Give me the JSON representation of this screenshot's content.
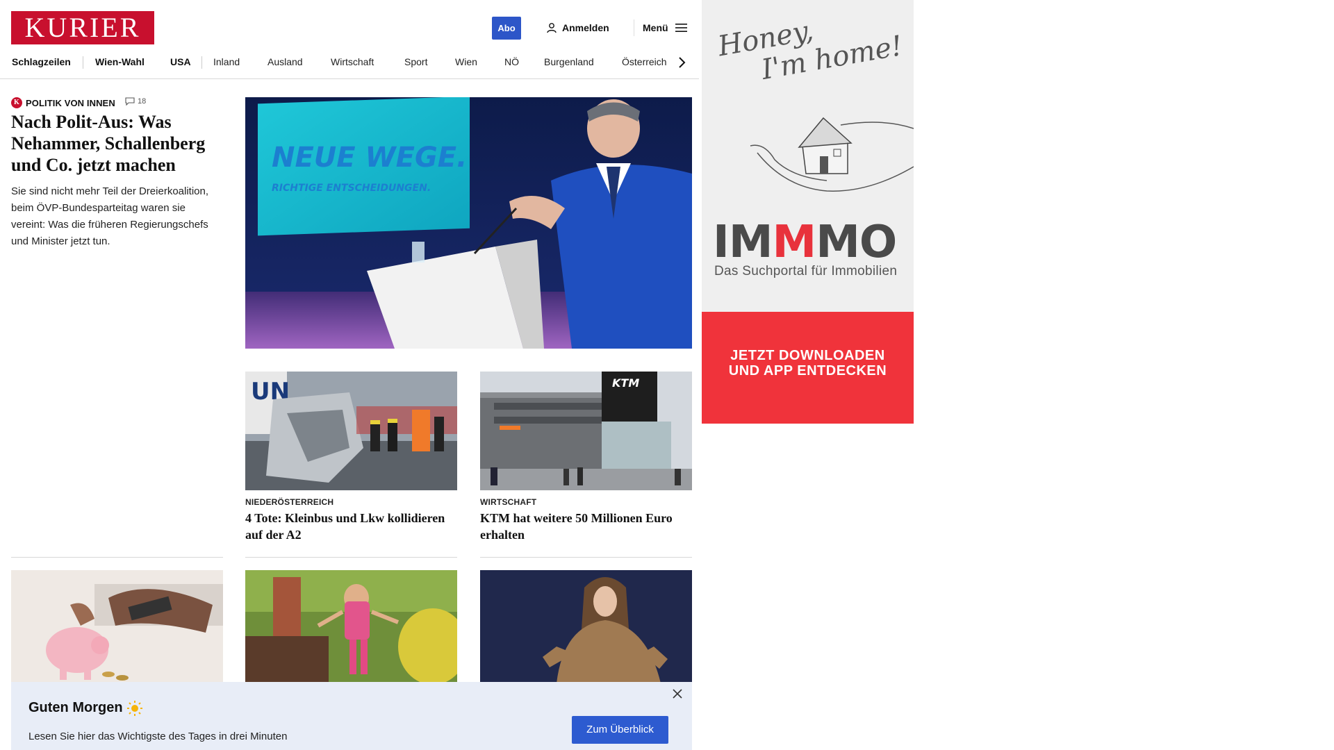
{
  "header": {
    "logo_text": "KURIER",
    "abo_label": "Abo",
    "login_label": "Anmelden",
    "menu_label": "Menü"
  },
  "nav": {
    "items": [
      "Schlagzeilen",
      "Wien-Wahl",
      "USA",
      "Inland",
      "Ausland",
      "Wirtschaft",
      "Sport",
      "Wien",
      "NÖ",
      "Burgenland",
      "Österreich"
    ]
  },
  "lead": {
    "badge_letter": "K",
    "kicker": "POLITIK VON INNEN",
    "comment_count": "18",
    "title": "Nach Polit-Aus: Was Nehammer, Schallenberg und Co. jetzt machen",
    "teaser": "Sie sind nicht mehr Teil der Dreierkoalition, beim ÖVP-Bundesparteitag waren sie vereint: Was die früheren Regierungschefs und Minister jetzt tun.",
    "image_text_line1": "NEUE WEGE.",
    "image_text_line2": "RICHTIGE ENTSCHEIDUNGEN."
  },
  "cards": [
    {
      "kicker": "NIEDERÖSTERREICH",
      "title": "4 Tote: Kleinbus und Lkw kollidieren auf der A2",
      "image_label": "UN"
    },
    {
      "kicker": "WIRTSCHAFT",
      "title": "KTM hat weitere 50 Millionen Euro erhalten",
      "image_label": "KTM"
    }
  ],
  "briefing": {
    "title": "Guten Morgen",
    "text": "Lesen Sie hier das Wichtigste des Tages in drei Minuten",
    "button_label": "Zum Überblick"
  },
  "ad": {
    "script_line1": "Honey,",
    "script_line2": "I'm home!",
    "brand_part1": "IM",
    "brand_part2": "M",
    "brand_part3": "MO",
    "subline": "Das Suchportal für Immobilien",
    "cta_line1": "JETZT DOWNLOADEN",
    "cta_line2": "UND APP ENTDECKEN"
  },
  "colors": {
    "brand_red": "#c8102e",
    "accent_blue": "#2d56c8",
    "ad_red": "#f0333b",
    "briefing_bg": "#e8edf7"
  },
  "icons": [
    "user-icon",
    "hamburger-icon",
    "chevron-right-icon",
    "comment-icon",
    "sun-icon",
    "close-icon"
  ]
}
